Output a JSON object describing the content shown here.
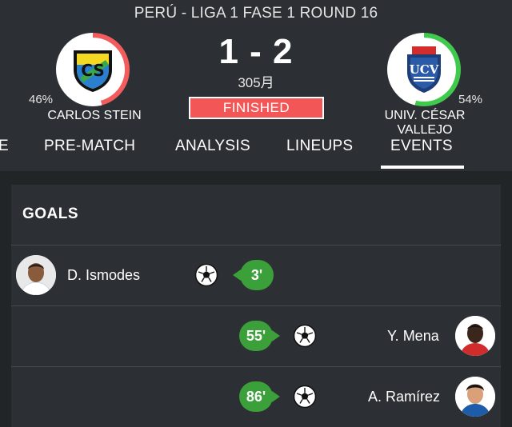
{
  "match": {
    "league_title": "PERÚ - LIGA 1 FASE 1 ROUND 16",
    "score": "1 - 2",
    "date": "305月",
    "status": "FINISHED",
    "home": {
      "name": "CARLOS STEIN",
      "percent": "46%",
      "percent_value": 0.46,
      "ring_color": "#f25c5c"
    },
    "away": {
      "name": "UNIV. CÉSAR VALLEJO",
      "percent": "54%",
      "percent_value": 0.54,
      "ring_color": "#3fc94d"
    }
  },
  "tabs": [
    {
      "label": "E"
    },
    {
      "label": "PRE-MATCH"
    },
    {
      "label": "ANALYSIS"
    },
    {
      "label": "LINEUPS"
    },
    {
      "label": "EVENTS",
      "active": true
    }
  ],
  "goals": {
    "heading": "GOALS",
    "events": [
      {
        "player": "D. Ismodes",
        "minute": "3'",
        "side": "home"
      },
      {
        "player": "Y. Mena",
        "minute": "55'",
        "side": "away"
      },
      {
        "player": "A. Ramírez",
        "minute": "86'",
        "side": "away"
      }
    ]
  },
  "icons": {
    "home_logo": "carlos-stein-crest",
    "away_logo": "ucv-crest",
    "ball": "soccer-ball-icon"
  },
  "colors": {
    "background": "#2c2f33",
    "status_badge": "#f25656",
    "minute_badge": "#3ba03a"
  }
}
